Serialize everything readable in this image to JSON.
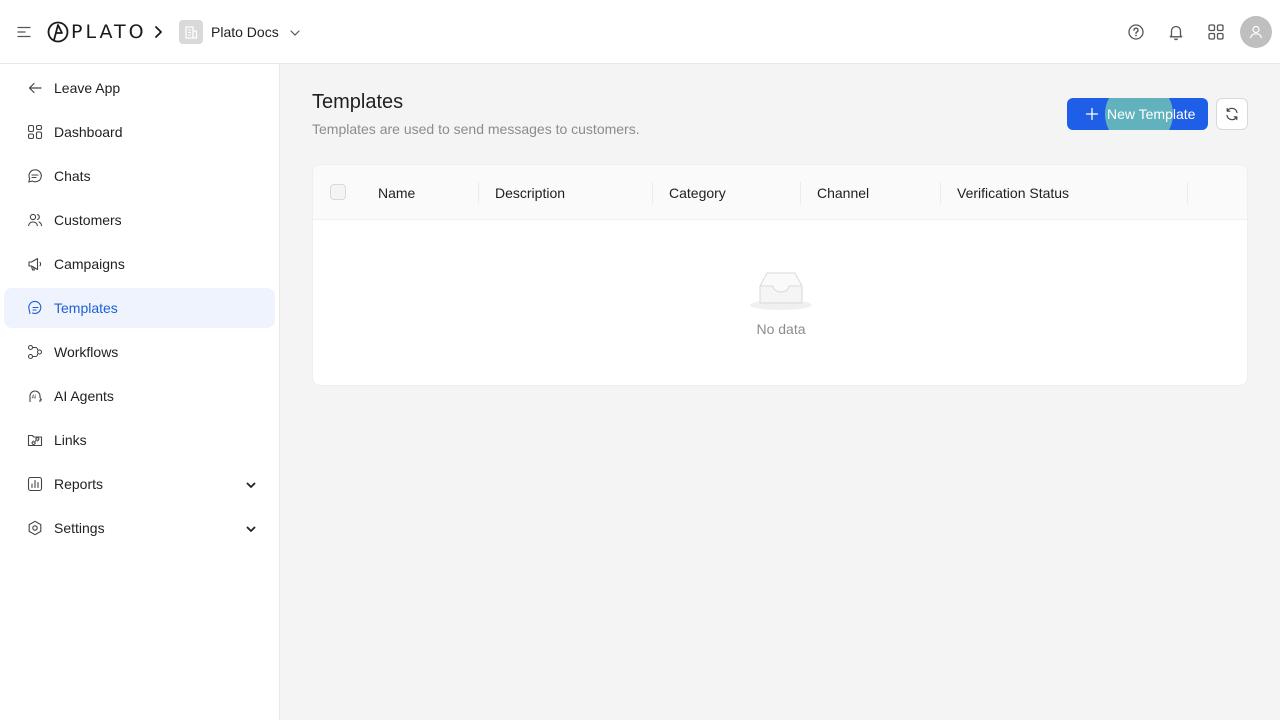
{
  "header": {
    "logo_text": "PLATO",
    "workspace": "Plato Docs"
  },
  "sidebar": {
    "items": [
      {
        "label": "Leave App",
        "icon": "arrow-left-icon"
      },
      {
        "label": "Dashboard",
        "icon": "dashboard-icon"
      },
      {
        "label": "Chats",
        "icon": "chat-icon"
      },
      {
        "label": "Customers",
        "icon": "users-icon"
      },
      {
        "label": "Campaigns",
        "icon": "megaphone-icon"
      },
      {
        "label": "Templates",
        "icon": "template-icon",
        "active": true
      },
      {
        "label": "Workflows",
        "icon": "workflow-icon"
      },
      {
        "label": "AI Agents",
        "icon": "ai-agent-icon"
      },
      {
        "label": "Links",
        "icon": "link-icon"
      },
      {
        "label": "Reports",
        "icon": "reports-icon",
        "expandable": true
      },
      {
        "label": "Settings",
        "icon": "settings-icon",
        "expandable": true
      }
    ]
  },
  "main": {
    "title": "Templates",
    "subtitle": "Templates are used to send messages to customers.",
    "new_button_label": "New Template",
    "table": {
      "columns": [
        "Name",
        "Description",
        "Category",
        "Channel",
        "Verification Status"
      ],
      "empty_text": "No data"
    }
  },
  "colors": {
    "primary": "#1f5fe8",
    "active_bg": "#eef3fe",
    "active_text": "#1f5fd6"
  }
}
